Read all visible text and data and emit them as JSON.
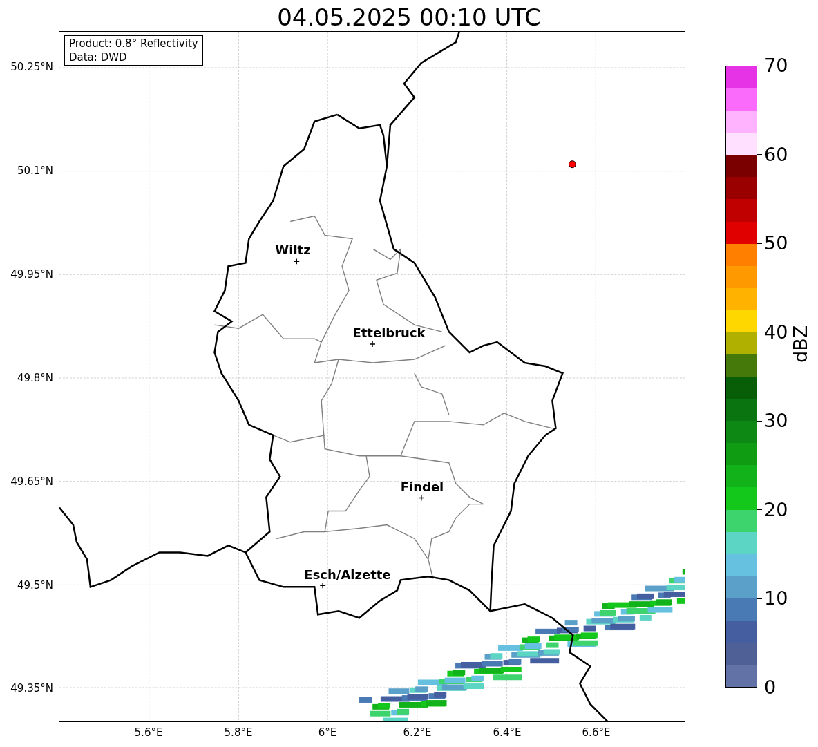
{
  "title": "04.05.2025 00:10 UTC",
  "info_box": [
    "Product: 0.8° Reflectivity",
    "Data: DWD"
  ],
  "y_ticks": [
    "50.25°N",
    "50.1°N",
    "49.95°N",
    "49.8°N",
    "49.65°N",
    "49.5°N",
    "49.35°N"
  ],
  "x_ticks": [
    "5.6°E",
    "5.8°E",
    "6°E",
    "6.2°E",
    "6.4°E",
    "6.6°E"
  ],
  "cities": [
    "Wiltz",
    "Ettelbruck",
    "Findel",
    "Esch/Alzette"
  ],
  "colorbar": {
    "label": "dBZ",
    "ticks": [
      "70",
      "60",
      "50",
      "40",
      "30",
      "20",
      "10",
      "0"
    ],
    "segments": [
      {
        "color": "#e633e6"
      },
      {
        "color": "#fb6bfb"
      },
      {
        "color": "#ffb3ff"
      },
      {
        "color": "#ffe0ff"
      },
      {
        "color": "#7a0000"
      },
      {
        "color": "#9a0000"
      },
      {
        "color": "#c00000"
      },
      {
        "color": "#e00000"
      },
      {
        "color": "#ff7f00"
      },
      {
        "color": "#ff9900"
      },
      {
        "color": "#ffb300"
      },
      {
        "color": "#ffd700"
      },
      {
        "color": "#b0b000"
      },
      {
        "color": "#457a0a"
      },
      {
        "color": "#075e07"
      },
      {
        "color": "#0a7510"
      },
      {
        "color": "#0d8814"
      },
      {
        "color": "#109c12"
      },
      {
        "color": "#12b31a"
      },
      {
        "color": "#13c81b"
      },
      {
        "color": "#3dd46e"
      },
      {
        "color": "#5dd5c5"
      },
      {
        "color": "#66c0e0"
      },
      {
        "color": "#5aa0c8"
      },
      {
        "color": "#4a7ab4"
      },
      {
        "color": "#445ea0"
      },
      {
        "color": "#4e6096"
      },
      {
        "color": "#6272a6"
      }
    ]
  }
}
